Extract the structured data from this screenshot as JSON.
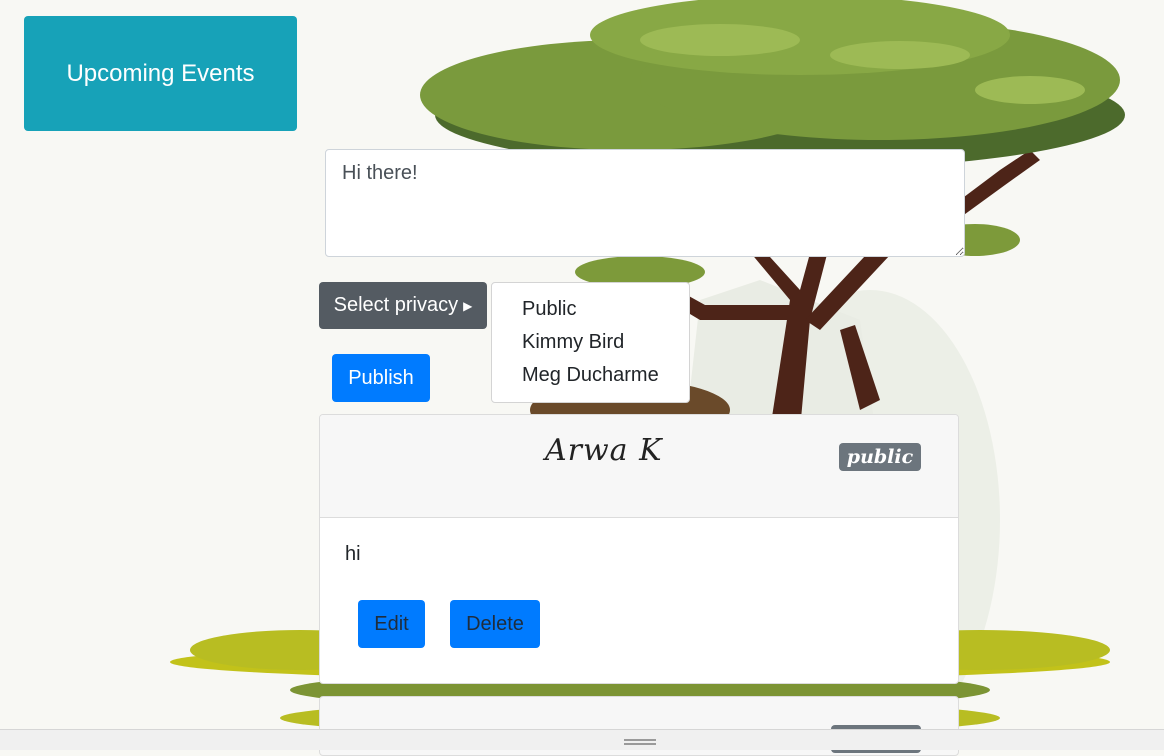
{
  "nav": {
    "upcoming_events_label": "Upcoming Events"
  },
  "composer": {
    "post_text": "Hi there!",
    "privacy_button_label": "Select privacy",
    "privacy_options": [
      "Public",
      "Kimmy Bird",
      "Meg Ducharme"
    ],
    "publish_label": "Publish"
  },
  "posts": [
    {
      "author": "Arwa K",
      "privacy": "public",
      "text": "hi",
      "edit_label": "Edit",
      "delete_label": "Delete"
    }
  ],
  "colors": {
    "events_button": "#17a2b8",
    "privacy_button": "#545b62",
    "primary": "#007bff",
    "badge": "#6c757d"
  },
  "icons": {
    "privacy_caret": "caret-right-icon",
    "resize_handle": "drag-handle-icon"
  }
}
